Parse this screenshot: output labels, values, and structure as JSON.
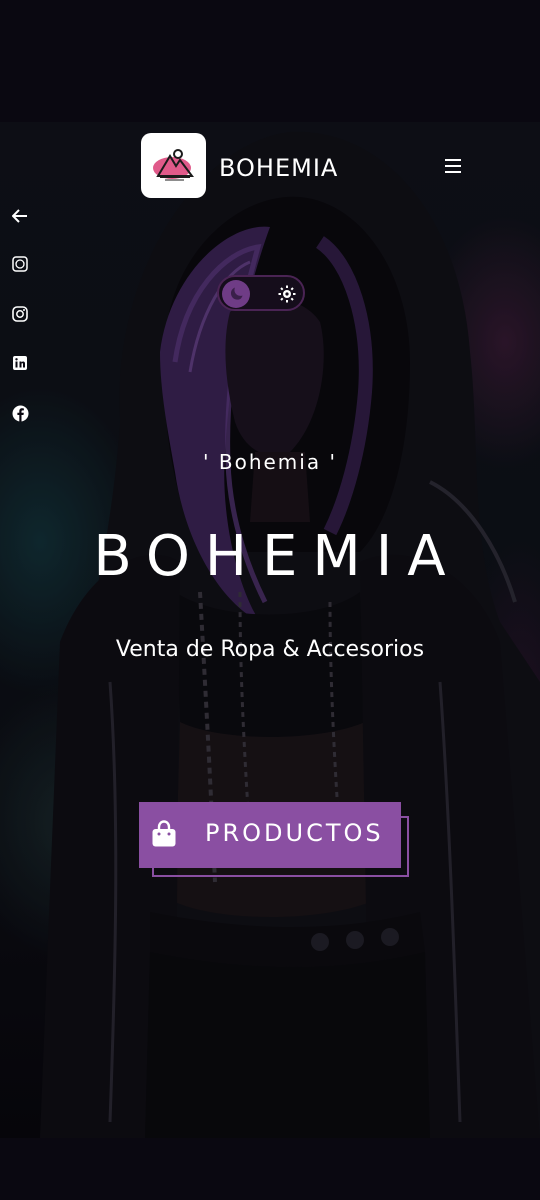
{
  "header": {
    "brand": "BOHEMIA",
    "menu_icon": "hamburger-icon"
  },
  "social_rail": [
    {
      "icon": "arrow-left-icon"
    },
    {
      "icon": "whatsapp-icon"
    },
    {
      "icon": "instagram-icon"
    },
    {
      "icon": "linkedin-icon"
    },
    {
      "icon": "facebook-icon"
    }
  ],
  "theme_toggle": {
    "dark_icon": "moon-icon",
    "light_icon": "sun-icon",
    "active": "dark"
  },
  "hero": {
    "quote": "' Bohemia '",
    "title": "BOHEMIA",
    "tagline": "Venta de Ropa & Accesorios",
    "cta_label": "PRODUCTOS",
    "cta_icon": "shopping-bag-icon"
  },
  "colors": {
    "accent": "#8a4fa2",
    "background": "#0a0811",
    "logo_pink": "#e05a8a"
  }
}
